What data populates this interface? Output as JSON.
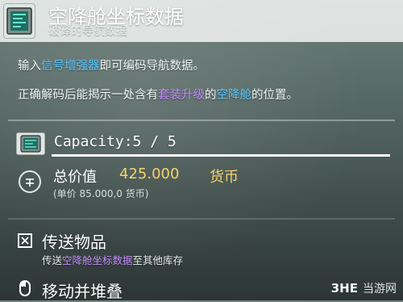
{
  "header": {
    "title": "空降舱坐标数据",
    "subtitle": "破译的导航数据",
    "icon": "nav-data-item-icon"
  },
  "description": {
    "line1": {
      "pre": "输入",
      "highlight": "信号增强器",
      "post": "即可编码导航数据。"
    },
    "line2": {
      "pre": "正确解码后能揭示一处含有",
      "highlight1": "套装升级",
      "mid": "的",
      "highlight2": "空降舱",
      "post": "的位置。"
    }
  },
  "stats": {
    "capacity": "Capacity:5 / 5",
    "total_value_label": "总价值",
    "total_value": "425.000",
    "currency": "货币",
    "unit_price": "(单价 85.000,0 货币)"
  },
  "actions": {
    "transfer": {
      "label": "传送物品",
      "desc_pre": "传送",
      "desc_highlight": "空降舱坐标数据",
      "desc_post": "至其他库存"
    },
    "move_stack": {
      "label": "移动并堆叠"
    }
  },
  "watermark": {
    "logo": "3HE",
    "text": "当游网"
  },
  "colors": {
    "highlight_blue": "#59c8ff",
    "highlight_purple": "#c58cff",
    "value_gold": "#f6d26b"
  }
}
